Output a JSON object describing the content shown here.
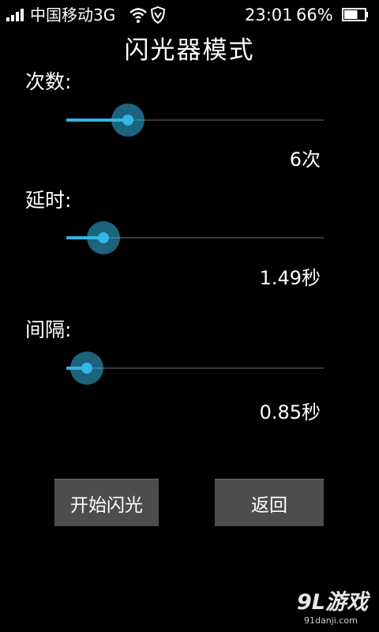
{
  "status_bar": {
    "carrier": "中国移动3G",
    "time": "23:01",
    "battery": "66%",
    "battery_level": 0.66
  },
  "title": "闪光器模式",
  "settings": [
    {
      "label": "次数:",
      "value": "6次",
      "level": 0.24
    },
    {
      "label": "延时:",
      "value": "1.49秒",
      "level": 0.145
    },
    {
      "label": "间隔:",
      "value": "0.85秒",
      "level": 0.08
    }
  ],
  "buttons": {
    "start": "开始闪光",
    "back": "返回"
  },
  "watermark": {
    "logo": "9L游戏",
    "site": "91danji.com"
  },
  "colors": {
    "accent": "#33b5e5",
    "button_bg": "#4d4d4d",
    "background": "#000000"
  }
}
